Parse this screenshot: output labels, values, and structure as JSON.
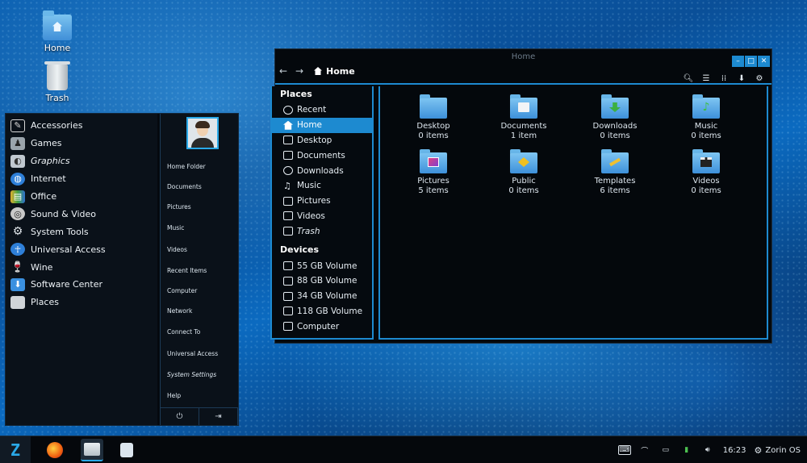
{
  "desktop": {
    "icons": [
      {
        "label": "Home"
      },
      {
        "label": "Trash"
      }
    ]
  },
  "menu": {
    "categories": [
      {
        "label": "Accessories",
        "icon": "accessories-icon",
        "color": "#d8d8d8"
      },
      {
        "label": "Games",
        "icon": "games-icon",
        "color": "#9aa4ac"
      },
      {
        "label": "Graphics",
        "icon": "graphics-icon",
        "color": "#c0c8d0"
      },
      {
        "label": "Internet",
        "icon": "globe-icon",
        "color": "#2e7fd8"
      },
      {
        "label": "Office",
        "icon": "office-icon",
        "color": "#e0b030"
      },
      {
        "label": "Sound & Video",
        "icon": "sound-video-icon",
        "color": "#c8c8c8"
      },
      {
        "label": "System Tools",
        "icon": "system-tools-icon",
        "color": "#b8c0c8"
      },
      {
        "label": "Universal Access",
        "icon": "accessibility-icon",
        "color": "#2e7fd8"
      },
      {
        "label": "Wine",
        "icon": "wine-icon",
        "color": "#b02828"
      },
      {
        "label": "Software Center",
        "icon": "software-center-icon",
        "color": "#3a90e0"
      },
      {
        "label": "Places",
        "icon": "places-icon",
        "color": "#d0d4d8"
      }
    ],
    "places": [
      {
        "label": "Home Folder"
      },
      {
        "label": "Documents"
      },
      {
        "label": "Pictures"
      },
      {
        "label": "Music"
      },
      {
        "label": "Videos"
      },
      {
        "label": "Recent Items"
      },
      {
        "label": "Computer"
      },
      {
        "label": "Network"
      },
      {
        "label": "Connect To"
      },
      {
        "label": "Universal Access"
      },
      {
        "label": "System Settings"
      },
      {
        "label": "Help"
      }
    ]
  },
  "file_manager": {
    "title": "Home",
    "breadcrumb": "Home",
    "sidebar": {
      "places_heading": "Places",
      "places": [
        {
          "label": "Recent"
        },
        {
          "label": "Home"
        },
        {
          "label": "Desktop"
        },
        {
          "label": "Documents"
        },
        {
          "label": "Downloads"
        },
        {
          "label": "Music"
        },
        {
          "label": "Pictures"
        },
        {
          "label": "Videos"
        },
        {
          "label": "Trash"
        }
      ],
      "devices_heading": "Devices",
      "devices": [
        {
          "label": "55 GB Volume"
        },
        {
          "label": "88 GB Volume"
        },
        {
          "label": "34 GB Volume"
        },
        {
          "label": "118 GB Volume"
        },
        {
          "label": "Computer"
        }
      ]
    },
    "folders": [
      {
        "name": "Desktop",
        "count": "0 items"
      },
      {
        "name": "Documents",
        "count": "1 item"
      },
      {
        "name": "Downloads",
        "count": "0 items"
      },
      {
        "name": "Music",
        "count": "0 items"
      },
      {
        "name": "Pictures",
        "count": "5 items"
      },
      {
        "name": "Public",
        "count": "0 items"
      },
      {
        "name": "Templates",
        "count": "6 items"
      },
      {
        "name": "Videos",
        "count": "0 items"
      }
    ]
  },
  "taskbar": {
    "clock": "16:23",
    "user": "Zorin OS"
  },
  "colors": {
    "accent": "#1d8ad0",
    "panel": "#0a1119"
  }
}
